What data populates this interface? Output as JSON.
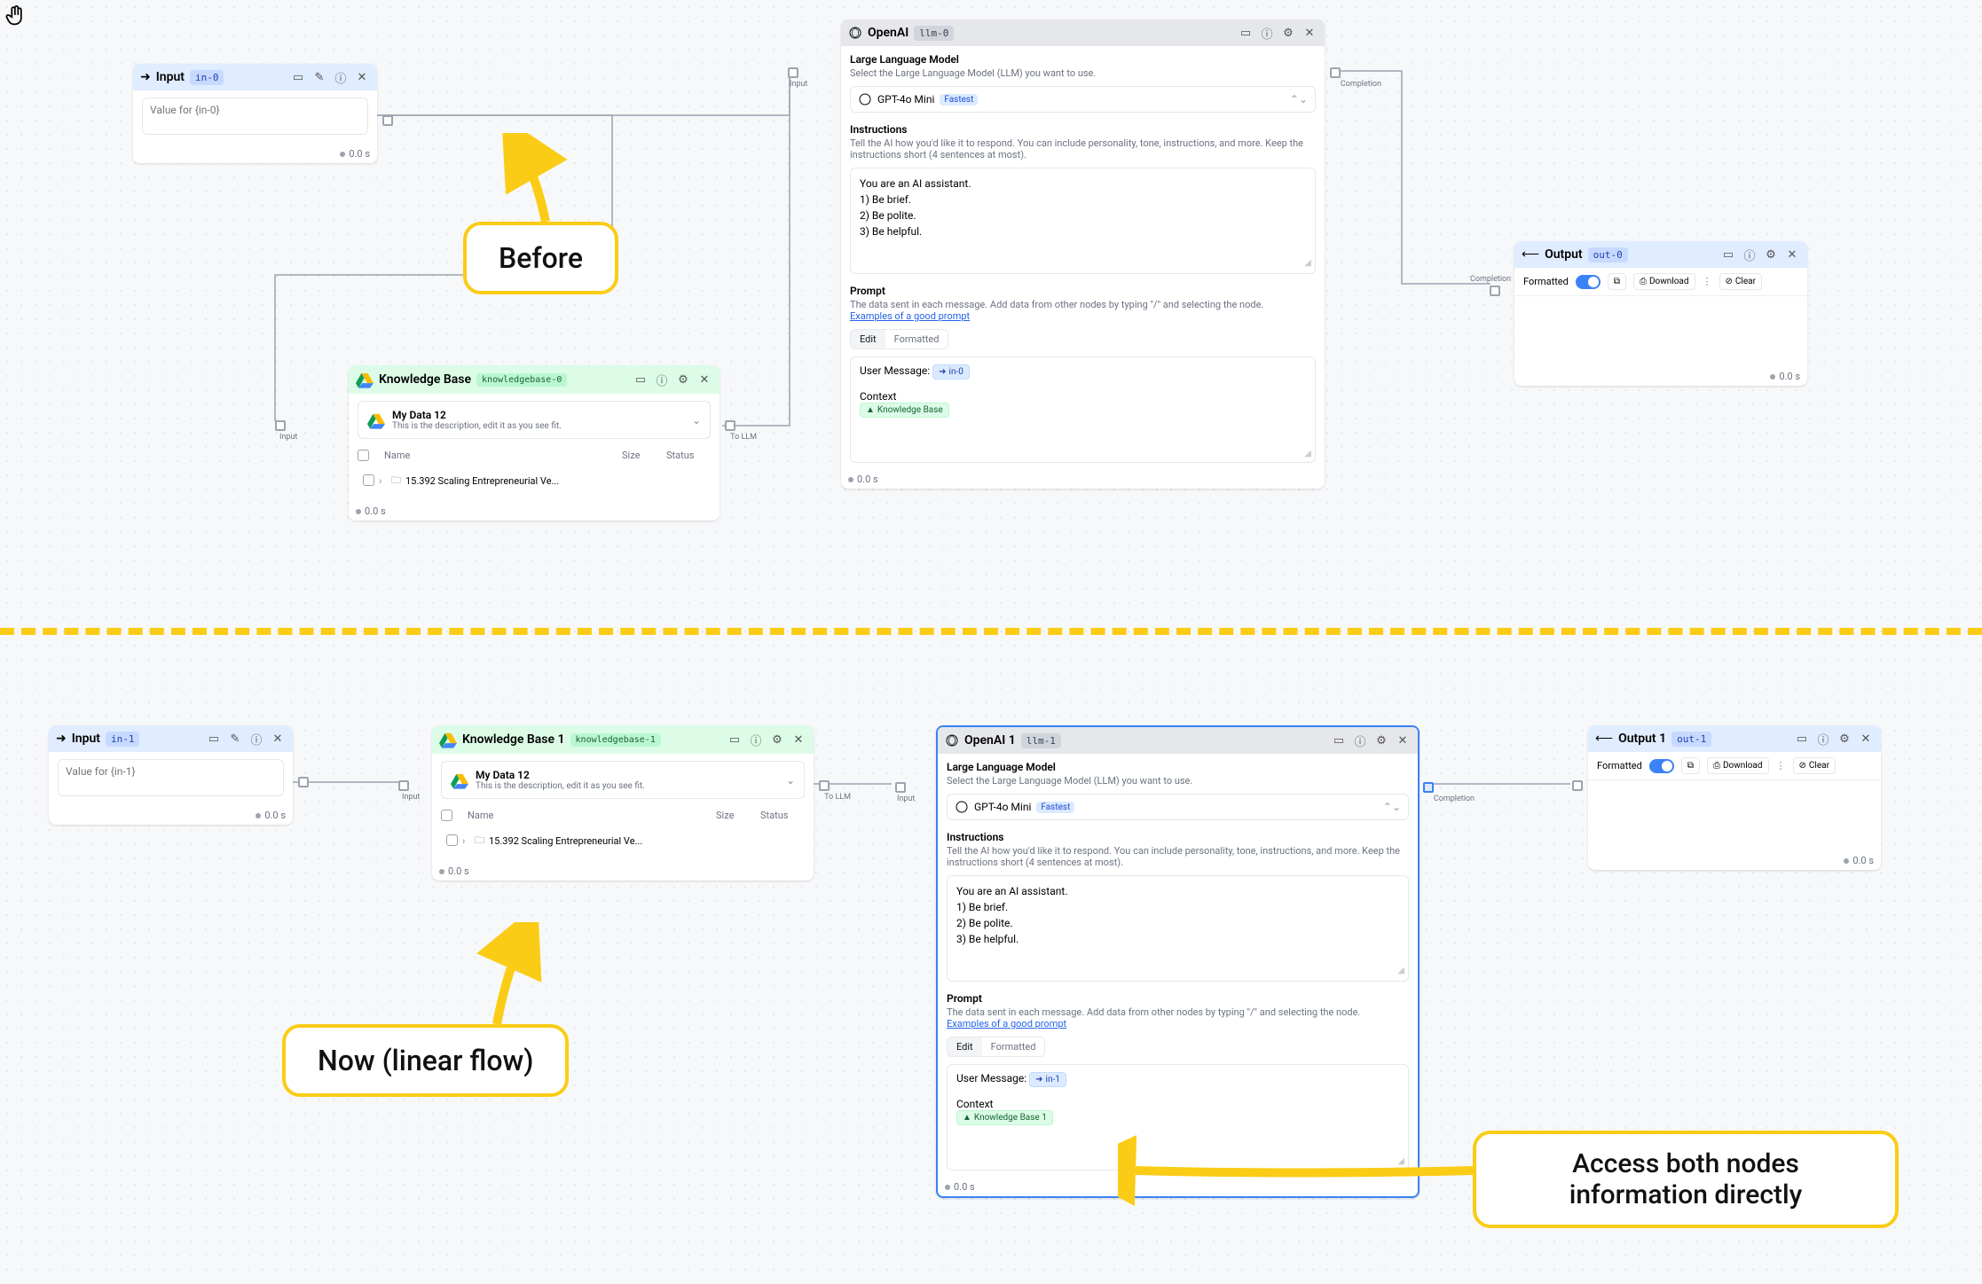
{
  "cursor": "hand",
  "before": {
    "label": "Before",
    "input": {
      "title": "Input",
      "badge": "in-0",
      "placeholder": "Value for {in-0}",
      "timer": "0.0 s"
    },
    "kb": {
      "title": "Knowledge Base",
      "badge": "knowledgebase-0",
      "data_name": "My Data 12",
      "data_desc": "This is the description, edit it as you see fit.",
      "cols": {
        "name": "Name",
        "size": "Size",
        "status": "Status"
      },
      "row1": "15.392 Scaling Entrepreneurial Ve...",
      "timer": "0.0 s",
      "port_in_label": "Input",
      "port_out_label": "To LLM"
    },
    "llm": {
      "title": "OpenAI",
      "badge": "llm-0",
      "section_model_title": "Large Language Model",
      "section_model_sub": "Select the Large Language Model (LLM) you want to use.",
      "model_name": "GPT-4o Mini",
      "model_pill": "Fastest",
      "section_instr_title": "Instructions",
      "section_instr_sub": "Tell the AI how you'd like it to respond. You can include personality, tone, instructions, and more. Keep the instructions short (4 sentences at most).",
      "instr_l1": "You are an AI assistant.",
      "instr_l2": "1) Be brief.",
      "instr_l3": "2) Be polite.",
      "instr_l4": "3) Be helpful.",
      "section_prompt_title": "Prompt",
      "section_prompt_sub": "The data sent in each message. Add data from other nodes by typing \"/\" and selecting the node.",
      "prompt_link": "Examples of a good prompt",
      "tab_edit": "Edit",
      "tab_formatted": "Formatted",
      "user_msg_label": "User Message:",
      "user_msg_chip": "in-0",
      "context_label": "Context",
      "context_chip": "Knowledge Base",
      "timer": "0.0 s",
      "port_in_label": "Input",
      "port_out_label": "Completion"
    },
    "output": {
      "title": "Output",
      "badge": "out-0",
      "formatted_label": "Formatted",
      "download_label": "Download",
      "clear_label": "Clear",
      "timer": "0.0 s",
      "port_label": "Completion"
    }
  },
  "now": {
    "label": "Now (linear flow)",
    "callout_access": "Access both nodes information directly",
    "input": {
      "title": "Input",
      "badge": "in-1",
      "placeholder": "Value for {in-1}",
      "timer": "0.0 s"
    },
    "kb": {
      "title": "Knowledge Base 1",
      "badge": "knowledgebase-1",
      "data_name": "My Data 12",
      "data_desc": "This is the description, edit it as you see fit.",
      "cols": {
        "name": "Name",
        "size": "Size",
        "status": "Status"
      },
      "row1": "15.392 Scaling Entrepreneurial Ve...",
      "timer": "0.0 s",
      "port_in_label": "Input",
      "port_out_label": "To LLM"
    },
    "llm": {
      "title": "OpenAI 1",
      "badge": "llm-1",
      "section_model_title": "Large Language Model",
      "section_model_sub": "Select the Large Language Model (LLM) you want to use.",
      "model_name": "GPT-4o Mini",
      "model_pill": "Fastest",
      "section_instr_title": "Instructions",
      "section_instr_sub": "Tell the AI how you'd like it to respond. You can include personality, tone, instructions, and more. Keep the instructions short (4 sentences at most).",
      "instr_l1": "You are an AI assistant.",
      "instr_l2": "1) Be brief.",
      "instr_l3": "2) Be polite.",
      "instr_l4": "3) Be helpful.",
      "section_prompt_title": "Prompt",
      "section_prompt_sub": "The data sent in each message. Add data from other nodes by typing \"/\" and selecting the node.",
      "prompt_link": "Examples of a good prompt",
      "tab_edit": "Edit",
      "tab_formatted": "Formatted",
      "user_msg_label": "User Message:",
      "user_msg_chip": "in-1",
      "context_label": "Context",
      "context_chip": "Knowledge Base 1",
      "timer": "0.0 s",
      "port_in_label": "Input",
      "port_out_label": "Completion"
    },
    "output": {
      "title": "Output 1",
      "badge": "out-1",
      "formatted_label": "Formatted",
      "download_label": "Download",
      "clear_label": "Clear",
      "timer": "0.0 s"
    }
  }
}
